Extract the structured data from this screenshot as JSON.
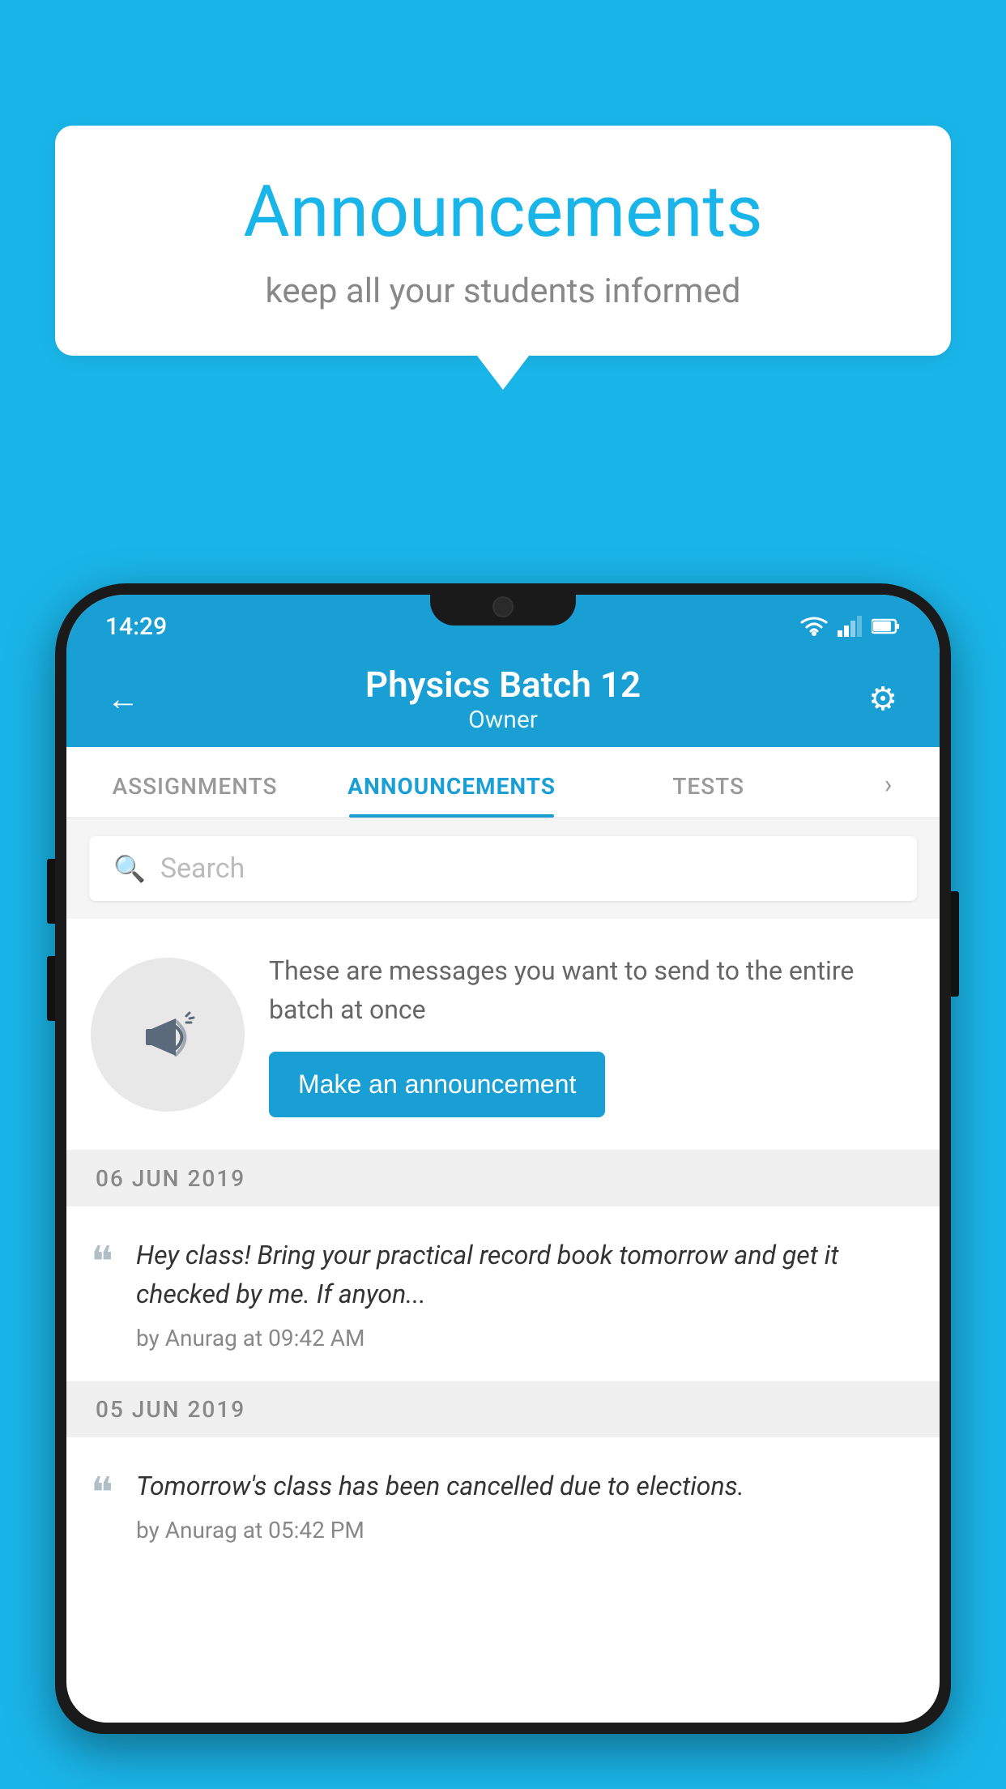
{
  "background": {
    "color": "#1ab5e8"
  },
  "speech_bubble": {
    "title": "Announcements",
    "subtitle": "keep all your students informed"
  },
  "phone": {
    "status_bar": {
      "time": "14:29"
    },
    "header": {
      "title": "Physics Batch 12",
      "subtitle": "Owner",
      "back_label": "←",
      "gear_label": "⚙"
    },
    "tabs": [
      {
        "label": "ASSIGNMENTS",
        "active": false
      },
      {
        "label": "ANNOUNCEMENTS",
        "active": true
      },
      {
        "label": "TESTS",
        "active": false
      }
    ],
    "search": {
      "placeholder": "Search"
    },
    "promo": {
      "description": "These are messages you want to send to the entire batch at once",
      "button_label": "Make an announcement"
    },
    "announcements": [
      {
        "date": "06  JUN  2019",
        "text": "Hey class! Bring your practical record book tomorrow and get it checked by me. If anyon...",
        "meta": "by Anurag at 09:42 AM"
      },
      {
        "date": "05  JUN  2019",
        "text": "Tomorrow's class has been cancelled due to elections.",
        "meta": "by Anurag at 05:42 PM"
      }
    ]
  }
}
